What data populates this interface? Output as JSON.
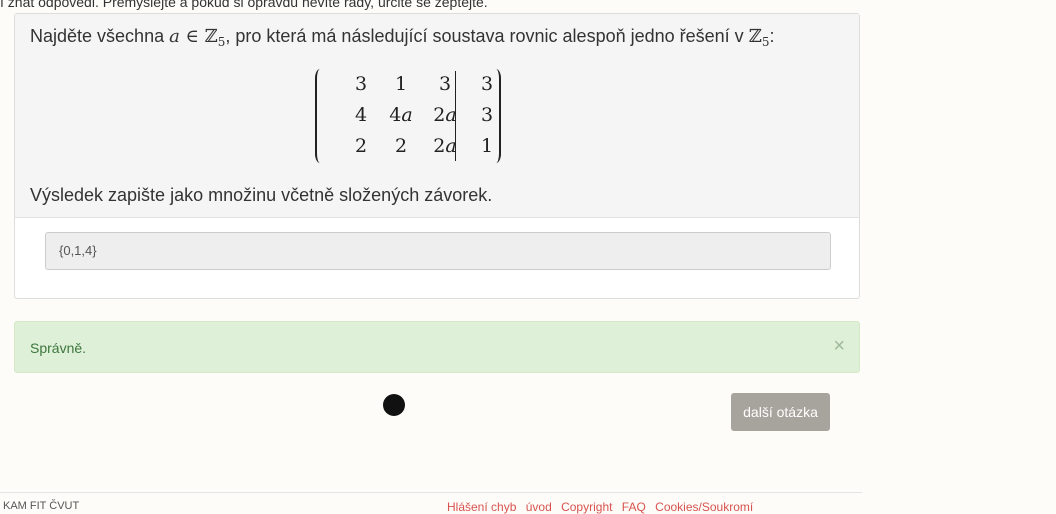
{
  "top_note": "í znát odpovědi. Přemýšlejte a pokud si opravdu nevíte rady, určitě se zeptejte.",
  "question": {
    "line1_pre": "Najděte všechna ",
    "var_a": "a",
    "in_symbol": " ∈ ",
    "set_Z": "ℤ",
    "sub_5": "5",
    "line1_mid": ", pro která má následující soustava rovnic alespoň jedno řešení v ",
    "line1_end": ":",
    "line2": "Výsledek zapište jako množinu včetně složených závorek.",
    "matrix": [
      [
        "3",
        "1",
        "3",
        "3"
      ],
      [
        "4",
        "4a",
        "2a",
        "3"
      ],
      [
        "2",
        "2",
        "2a",
        "1"
      ]
    ]
  },
  "answer": {
    "value": "{0,1,4}"
  },
  "alert": {
    "text": "Správně.",
    "close": "×"
  },
  "next_button": "další otázka",
  "footer": {
    "left": "KAM FIT ČVUT",
    "links": [
      "Hlášení chyb",
      "úvod",
      "Copyright",
      "FAQ",
      "Cookies/Soukromí"
    ]
  },
  "colors": {
    "success_bg": "#dff0d8",
    "success_text": "#3c763d",
    "button_bg": "#a7a39d",
    "footer_link": "#d9534f"
  }
}
